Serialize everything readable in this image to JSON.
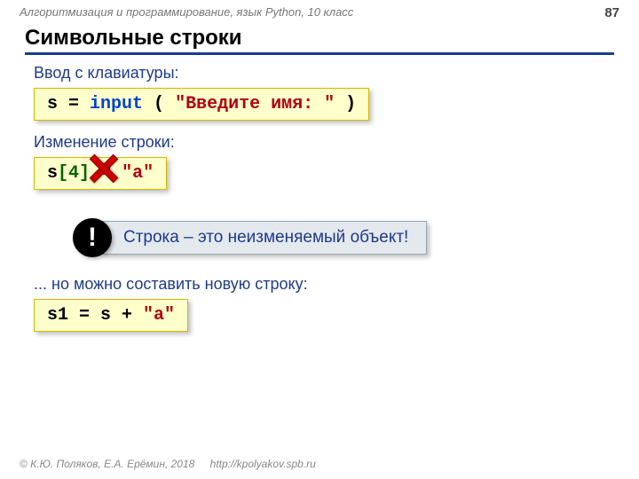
{
  "header": {
    "course": "Алгоритмизация и программирование, язык Python, 10 класс",
    "page": "87"
  },
  "title": "Символьные строки",
  "sections": {
    "input_label": "Ввод с клавиатуры:",
    "modify_label": "Изменение строки:",
    "newstr_label": "... но можно составить новую строку:"
  },
  "code": {
    "input_s": "s",
    "input_eq": " = ",
    "input_func": "input",
    "input_paren_l": " ( ",
    "input_arg": "\"Введите имя: \"",
    "input_paren_r": " )",
    "mod_s": "s",
    "mod_br_l": "[",
    "mod_idx": "4",
    "mod_br_r": "]",
    "mod_eq": " = ",
    "mod_val": "\"a\"",
    "new_s1": "s1 = s + ",
    "new_val": "\"a\""
  },
  "callout": {
    "bang": "!",
    "text": "Строка – это неизменяемый объект!"
  },
  "footer": {
    "copyright": "© К.Ю. Поляков, Е.А. Ерёмин, 2018",
    "url": "http://kpolyakov.spb.ru"
  }
}
